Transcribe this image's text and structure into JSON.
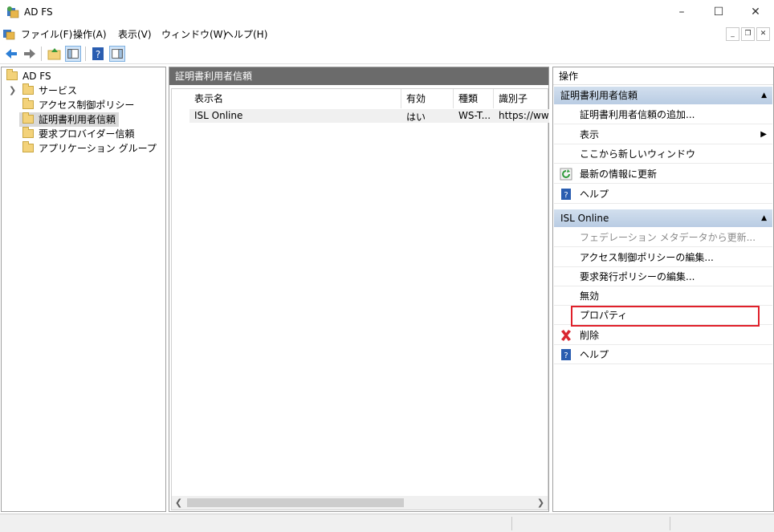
{
  "window": {
    "title": "AD FS"
  },
  "menu": {
    "items": [
      {
        "label": "ファイル(F)"
      },
      {
        "label": "操作(A)"
      },
      {
        "label": "表示(V)"
      },
      {
        "label": "ウィンドウ(W)"
      },
      {
        "label": "ヘルプ(H)"
      }
    ]
  },
  "tree": {
    "root": "AD FS",
    "items": [
      {
        "label": "サービス"
      },
      {
        "label": "アクセス制御ポリシー"
      },
      {
        "label": "証明書利用者信頼"
      },
      {
        "label": "要求プロバイダー信頼"
      },
      {
        "label": "アプリケーション グループ"
      }
    ]
  },
  "center": {
    "header": "証明書利用者信頼",
    "columns": [
      "表示名",
      "有効",
      "種類",
      "識別子"
    ],
    "rows": [
      {
        "name": "ISL Online",
        "enabled": "はい",
        "type": "WS-T...",
        "identifier": "https://www"
      }
    ]
  },
  "actions": {
    "title": "操作",
    "section1": {
      "header": "証明書利用者信頼",
      "items": [
        {
          "label": "証明書利用者信頼の追加..."
        },
        {
          "label": "表示"
        },
        {
          "label": "ここから新しいウィンドウ"
        },
        {
          "label": "最新の情報に更新"
        },
        {
          "label": "ヘルプ"
        }
      ]
    },
    "section2": {
      "header": "ISL Online",
      "items": [
        {
          "label": "フェデレーション メタデータから更新..."
        },
        {
          "label": "アクセス制御ポリシーの編集..."
        },
        {
          "label": "要求発行ポリシーの編集..."
        },
        {
          "label": "無効"
        },
        {
          "label": "プロパティ"
        },
        {
          "label": "削除"
        },
        {
          "label": "ヘルプ"
        }
      ]
    }
  }
}
